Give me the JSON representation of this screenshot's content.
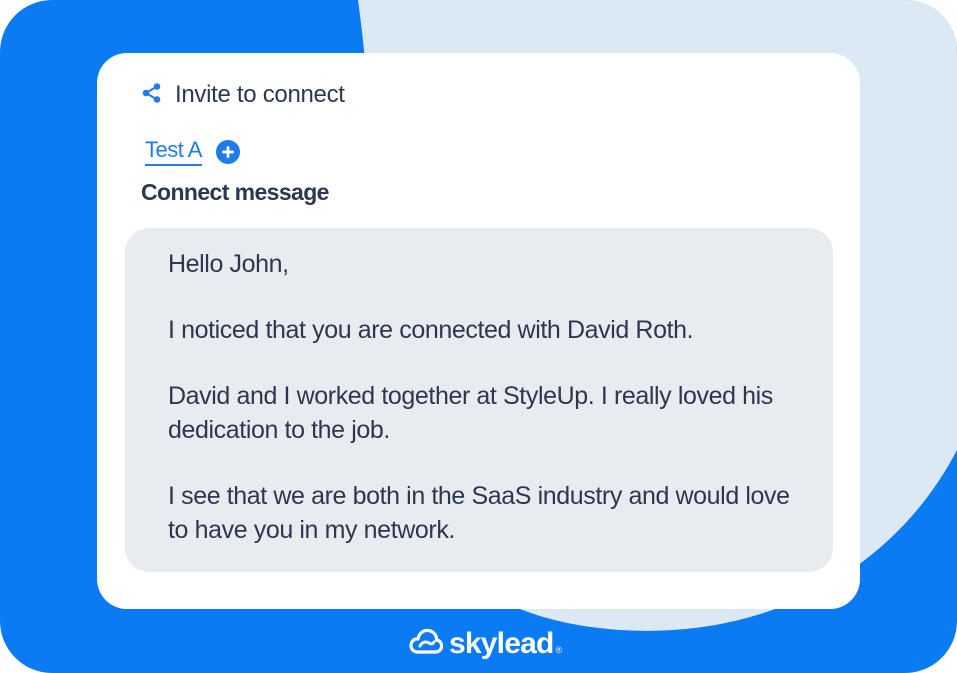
{
  "header": {
    "icon": "share-icon",
    "title": "Invite to connect"
  },
  "tabs": [
    {
      "label": "Test A",
      "active": true
    }
  ],
  "add_tab_icon": "plus-circle-icon",
  "section": {
    "title": "Connect message"
  },
  "message": {
    "paragraphs": [
      "Hello John,",
      "I noticed that you are connected with David Roth.",
      "David and I worked together at StyleUp. I really loved his dedication to the job.",
      "I see that we are both in the SaaS industry and would love to have you in my network."
    ]
  },
  "brand": {
    "logo_icon": "cloud-logo-icon",
    "name": "skylead",
    "registered_mark": "®"
  },
  "colors": {
    "primary_blue": "#0a7bf2",
    "light_blue": "#dbe9f5",
    "text_dark": "#2c3850",
    "link_blue": "#1f7cea",
    "message_bg": "#e8ebef"
  }
}
